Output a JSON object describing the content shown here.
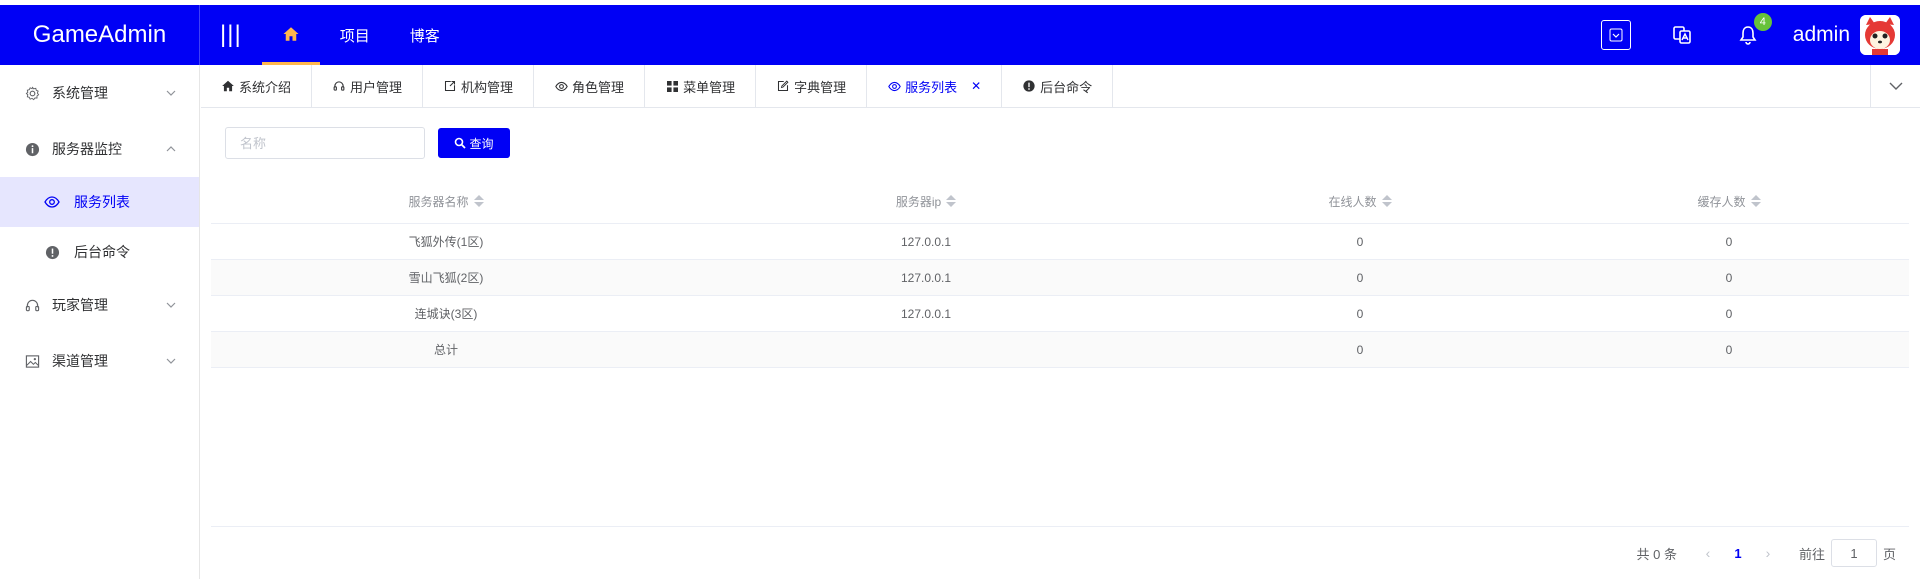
{
  "app": {
    "logo": "GameAdmin"
  },
  "header": {
    "nav": [
      {
        "label": "项目"
      },
      {
        "label": "博客"
      }
    ],
    "notification_count": "4",
    "user_name": "admin"
  },
  "sidebar": {
    "items": [
      {
        "label": "系统管理"
      },
      {
        "label": "服务器监控"
      },
      {
        "label": "服务列表"
      },
      {
        "label": "后台命令"
      },
      {
        "label": "玩家管理"
      },
      {
        "label": "渠道管理"
      }
    ]
  },
  "tabs": [
    {
      "label": "系统介绍"
    },
    {
      "label": "用户管理"
    },
    {
      "label": "机构管理"
    },
    {
      "label": "角色管理"
    },
    {
      "label": "菜单管理"
    },
    {
      "label": "字典管理"
    },
    {
      "label": "服务列表"
    },
    {
      "label": "后台命令"
    }
  ],
  "search": {
    "placeholder": "名称",
    "value": "",
    "button_label": "查询"
  },
  "table": {
    "columns": [
      "服务器名称",
      "服务器ip",
      "在线人数",
      "缓存人数"
    ],
    "rows": [
      [
        "飞狐外传(1区)",
        "127.0.0.1",
        "0",
        "0"
      ],
      [
        "雪山飞狐(2区)",
        "127.0.0.1",
        "0",
        "0"
      ],
      [
        "连城诀(3区)",
        "127.0.0.1",
        "0",
        "0"
      ],
      [
        "总计",
        "",
        "0",
        "0"
      ]
    ]
  },
  "pagination": {
    "total_text": "共 0 条",
    "current_page": "1",
    "goto_label": "前往",
    "goto_value": "1",
    "unit": "页"
  },
  "colors": {
    "primary": "#0000f5",
    "badge": "#67c23a",
    "active_bg": "#e6e6fe"
  }
}
